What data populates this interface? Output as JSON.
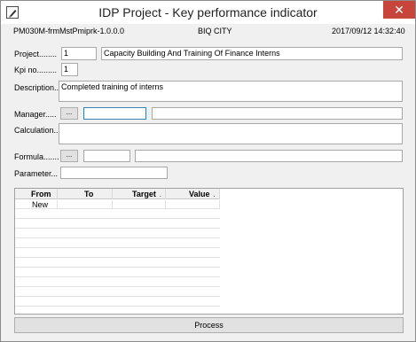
{
  "window": {
    "title": "IDP Project - Key performance indicator",
    "close_glyph": "✕"
  },
  "header": {
    "form_id": "PM030M-frmMstPmiprk-1.0.0.0",
    "city": "BIQ CITY",
    "datetime": "2017/09/12 14:32:40"
  },
  "fields": {
    "project": {
      "label": "Project........",
      "code": "1",
      "name": "Capacity Building And Training Of Finance Interns"
    },
    "kpi_no": {
      "label": "Kpi no.........",
      "value": "1"
    },
    "description": {
      "label": "Description..",
      "value": "Completed training of interns"
    },
    "manager": {
      "label": "Manager.....",
      "button": "...",
      "code": "",
      "name": ""
    },
    "calculation": {
      "label": "Calculation..",
      "value": ""
    },
    "formula": {
      "label": "Formula.......",
      "button": "...",
      "code": "",
      "name": ""
    },
    "parameter": {
      "label": "Parameter...",
      "value": ""
    }
  },
  "grid": {
    "columns": [
      {
        "label": "From",
        "sort": ""
      },
      {
        "label": "To",
        "sort": ""
      },
      {
        "label": "Target",
        "sort": "."
      },
      {
        "label": "Value",
        "sort": "."
      }
    ],
    "rows": [
      {
        "from": "New",
        "to": "",
        "target": "",
        "value": ""
      }
    ]
  },
  "process_button": "Process"
}
